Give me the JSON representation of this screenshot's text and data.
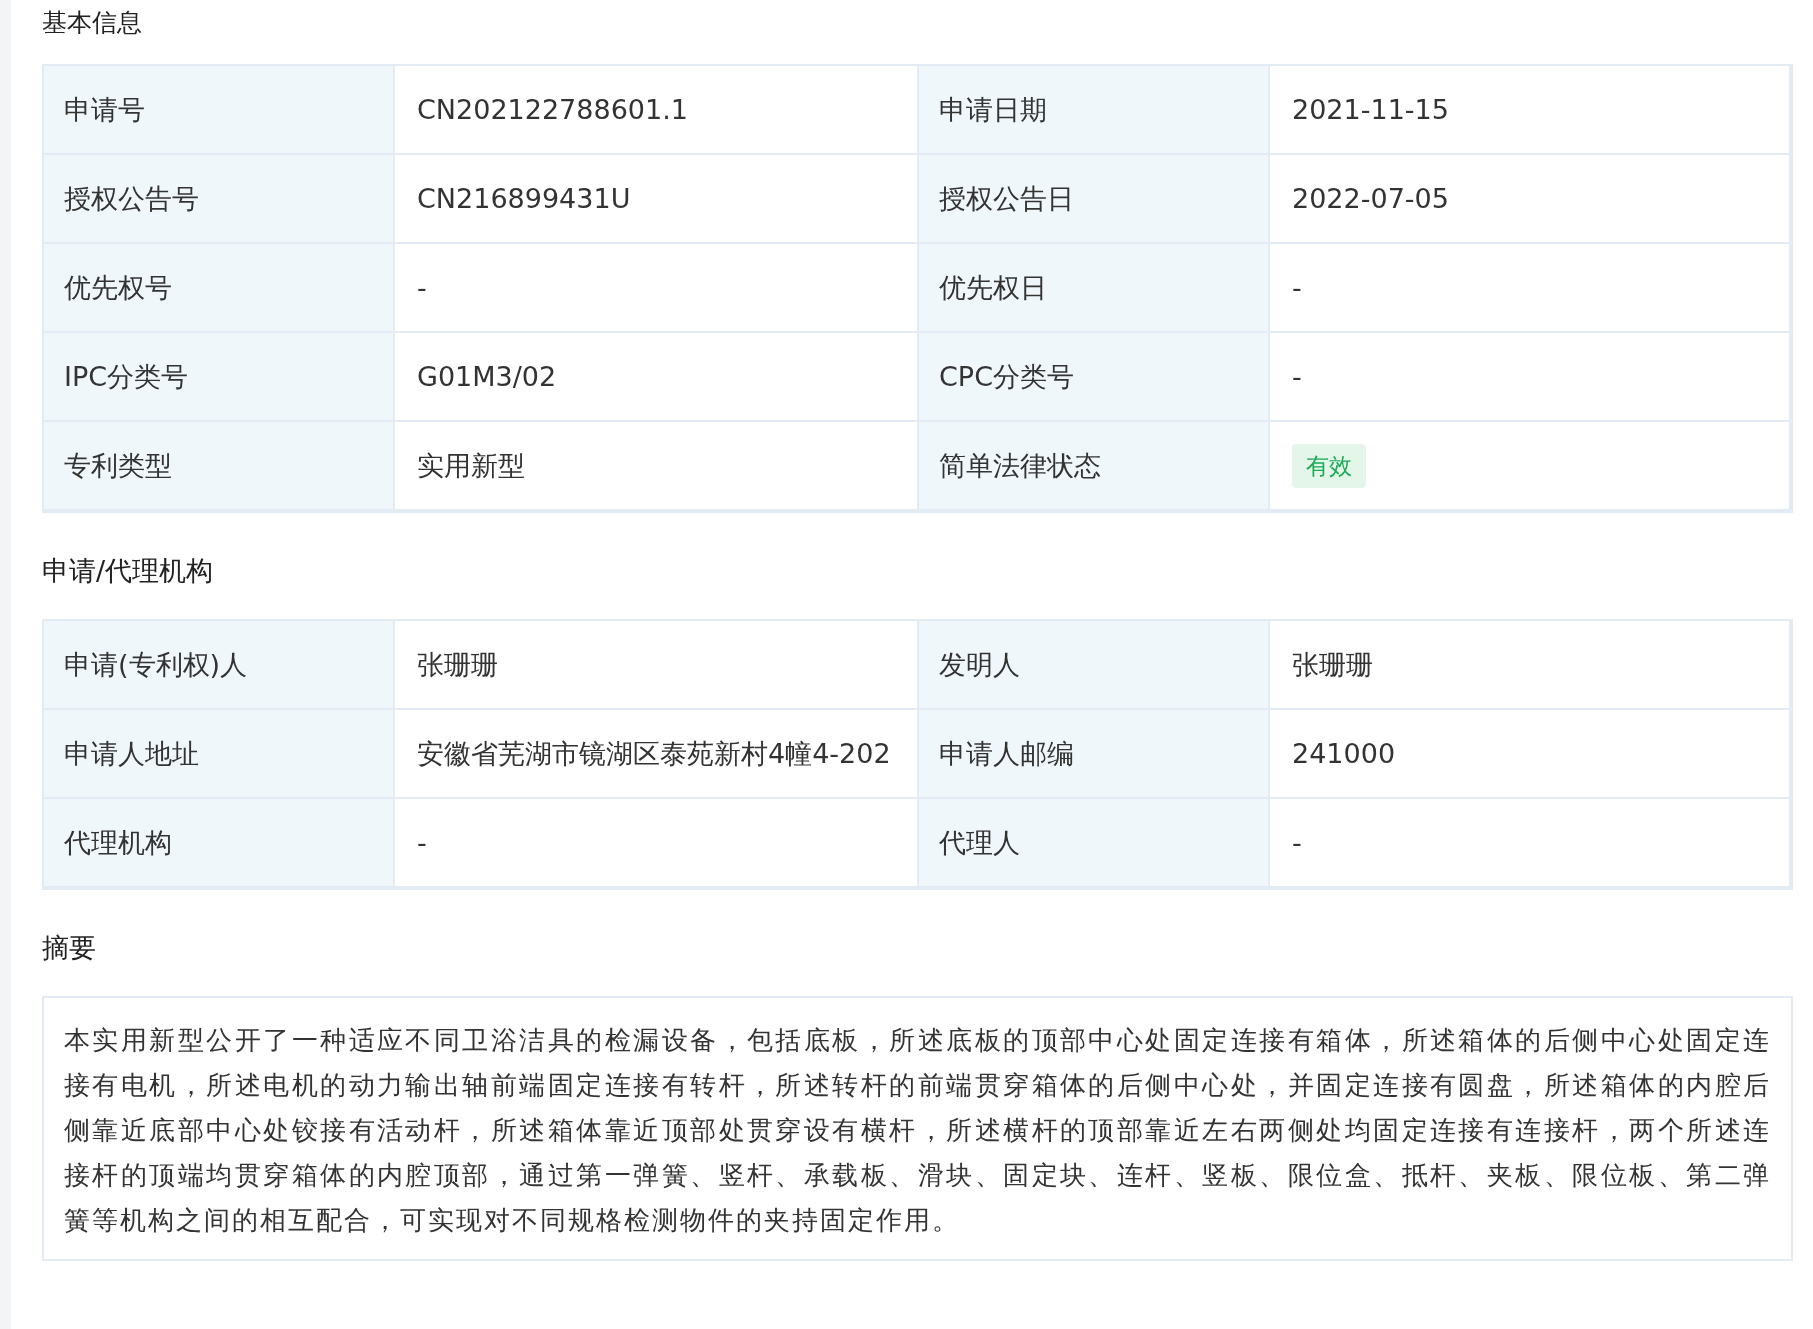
{
  "sections": [
    {
      "title": "基本信息",
      "kind": "table",
      "rows": [
        {
          "cells": [
            {
              "label": "申请号",
              "value": "CN202122788601.1",
              "kind": "text"
            },
            {
              "label": "申请日期",
              "value": "2021-11-15",
              "kind": "text"
            }
          ]
        },
        {
          "cells": [
            {
              "label": "授权公告号",
              "value": "CN216899431U",
              "kind": "text"
            },
            {
              "label": "授权公告日",
              "value": "2022-07-05",
              "kind": "text"
            }
          ]
        },
        {
          "cells": [
            {
              "label": "优先权号",
              "value": "-",
              "kind": "text"
            },
            {
              "label": "优先权日",
              "value": "-",
              "kind": "text"
            }
          ]
        },
        {
          "cells": [
            {
              "label": "IPC分类号",
              "value": "G01M3/02",
              "kind": "text"
            },
            {
              "label": "CPC分类号",
              "value": "-",
              "kind": "text"
            }
          ]
        },
        {
          "cells": [
            {
              "label": "专利类型",
              "value": "实用新型",
              "kind": "text"
            },
            {
              "label": "简单法律状态",
              "value": "有效",
              "kind": "badge"
            }
          ]
        }
      ]
    },
    {
      "title": "申请/代理机构",
      "kind": "table",
      "rows": [
        {
          "cells": [
            {
              "label": "申请(专利权)人",
              "value": "张珊珊",
              "kind": "text"
            },
            {
              "label": "发明人",
              "value": "张珊珊",
              "kind": "text"
            }
          ]
        },
        {
          "cells": [
            {
              "label": "申请人地址",
              "value": "安徽省芜湖市镜湖区泰苑新村4幢4-202",
              "kind": "text"
            },
            {
              "label": "申请人邮编",
              "value": "241000",
              "kind": "text"
            }
          ]
        },
        {
          "cells": [
            {
              "label": "代理机构",
              "value": "-",
              "kind": "text"
            },
            {
              "label": "代理人",
              "value": "-",
              "kind": "text"
            }
          ]
        }
      ]
    },
    {
      "title": "摘要",
      "kind": "text",
      "body": "本实用新型公开了一种适应不同卫浴洁具的检漏设备，包括底板，所述底板的顶部中心处固定连接有箱体，所述箱体的后侧中心处固定连接有电机，所述电机的动力输出轴前端固定连接有转杆，所述转杆的前端贯穿箱体的后侧中心处，并固定连接有圆盘，所述箱体的内腔后侧靠近底部中心处铰接有活动杆，所述箱体靠近顶部处贯穿设有横杆，所述横杆的顶部靠近左右两侧处均固定连接有连接杆，两个所述连接杆的顶端均贯穿箱体的内腔顶部，通过第一弹簧、竖杆、承载板、滑块、固定块、连杆、竖板、限位盒、抵杆、夹板、限位板、第二弹簧等机构之间的相互配合，可实现对不同规格检测物件的夹持固定作用。"
    }
  ]
}
